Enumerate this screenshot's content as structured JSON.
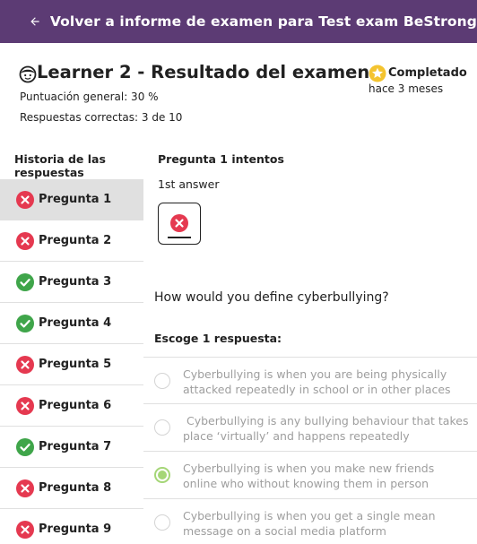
{
  "appbar": {
    "back_icon": "arrow-left-icon",
    "title": "Volver a informe de examen para Test exam BeStrong"
  },
  "header": {
    "learner_icon": "learner-face-icon",
    "title": "Learner 2 - Resultado del examen",
    "overall_score": "Puntuación general: 30 %",
    "correct_answers": "Respuestas correctas: 3 de 10",
    "status": {
      "icon": "star-icon",
      "label": "Completado",
      "time": "hace 3 meses",
      "color": "#f4c430"
    }
  },
  "sidebar": {
    "heading": "Historia de las respuestas",
    "items": [
      {
        "label": "Pregunta 1",
        "result": "incorrect",
        "active": true
      },
      {
        "label": "Pregunta 2",
        "result": "incorrect",
        "active": false
      },
      {
        "label": "Pregunta 3",
        "result": "correct",
        "active": false
      },
      {
        "label": "Pregunta 4",
        "result": "correct",
        "active": false
      },
      {
        "label": "Pregunta 5",
        "result": "incorrect",
        "active": false
      },
      {
        "label": "Pregunta 6",
        "result": "incorrect",
        "active": false
      },
      {
        "label": "Pregunta 7",
        "result": "correct",
        "active": false
      },
      {
        "label": "Pregunta 8",
        "result": "incorrect",
        "active": false
      },
      {
        "label": "Pregunta 9",
        "result": "incorrect",
        "active": false
      }
    ]
  },
  "main": {
    "attempts_title": "Pregunta 1 intentos",
    "answer_label": "1st answer",
    "attempt_result": "incorrect",
    "question": "How would you define cyberbullying?",
    "choose_label": "Escoge 1 respuesta:",
    "options": [
      {
        "text": "Cyberbullying is when you are being physically attacked repeatedly in school or in other places",
        "selected": false
      },
      {
        "text": " Cyberbullying is any bullying behaviour that takes place ‘virtually’ and happens repeatedly",
        "selected": false
      },
      {
        "text": "Cyberbullying is when you make new friends online who without knowing them in person",
        "selected": true
      },
      {
        "text": "Cyberbullying is when you get a single mean message on a social media platform",
        "selected": false
      }
    ]
  },
  "colors": {
    "appbar": "#5c3b74",
    "incorrect": "#e53950",
    "correct": "#3fa54a",
    "selected_radio": "#a5d677",
    "active_row": "#e0e0e0"
  }
}
